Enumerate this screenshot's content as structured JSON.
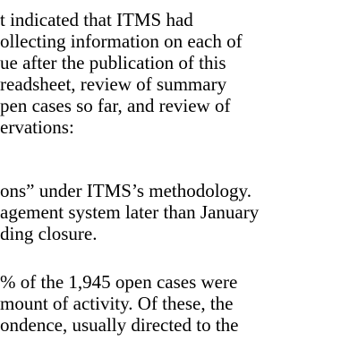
{
  "document": {
    "paragraph_1": [
      "t indicated that ITMS had",
      "ollecting information on each of",
      "ue after the publication of this",
      "readsheet, review of summary",
      "pen cases so far, and review of",
      "ervations:"
    ],
    "paragraph_2": [
      "ons” under ITMS’s methodology.",
      "agement system later than January",
      "ding closure."
    ],
    "paragraph_3": [
      "% of the 1,945 open cases were",
      "mount of activity. Of these, the",
      "ondence, usually directed to the"
    ]
  }
}
